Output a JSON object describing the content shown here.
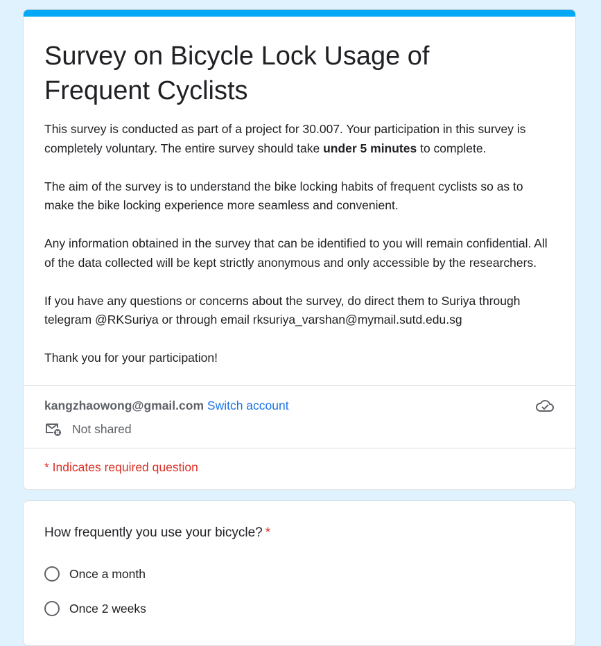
{
  "form": {
    "title_line1": "Survey on Bicycle Lock Usage of",
    "title_line2": "Frequent Cyclists",
    "description": {
      "p1_before": "This survey is conducted as part of a project for 30.007. Your participation in this survey is completely voluntary. The entire survey should take ",
      "p1_bold": "under 5 minutes",
      "p1_after": " to complete.",
      "p2": "The aim of the survey is to understand the bike locking habits of frequent cyclists so as to make the bike locking experience more seamless and convenient.",
      "p3": "Any information obtained in the survey that can be identified to you will remain confidential. All of the data collected will be kept strictly anonymous and only accessible by the researchers.",
      "p4": "If you have any questions or concerns about the survey, do direct them to Suriya through telegram @RKSuriya or through email rksuriya_varshan@mymail.sutd.edu.sg",
      "p5": "Thank you for your participation!"
    },
    "accent_color": "#03a9f4"
  },
  "account": {
    "email": "kangzhaowong@gmail.com",
    "switch_label": "Switch account",
    "shared_status": "Not shared",
    "shared_icon": "mail-not-shared-icon",
    "save_icon": "cloud-check-icon"
  },
  "required_note": "* Indicates required question",
  "question": {
    "title": "How frequently you use your bicycle?",
    "required_marker": "*",
    "options": [
      {
        "label": "Once a month"
      },
      {
        "label": "Once 2 weeks"
      }
    ]
  }
}
